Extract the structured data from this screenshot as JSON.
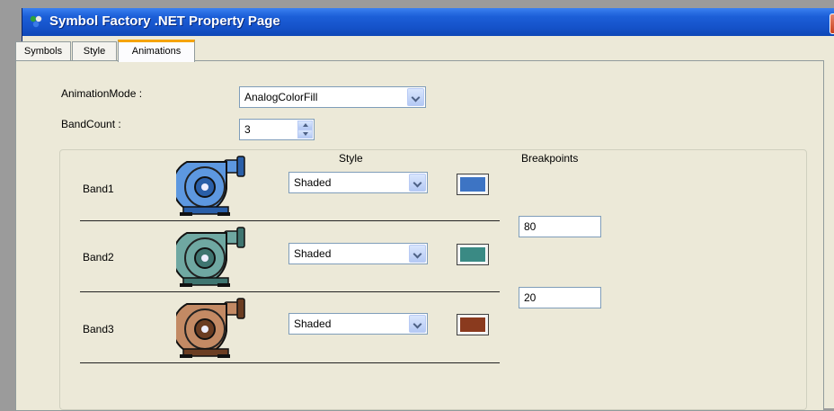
{
  "window": {
    "title": "Symbol Factory .NET Property Page",
    "icon": "app-icon"
  },
  "tabs": [
    {
      "label": "Symbols",
      "active": false
    },
    {
      "label": "Style",
      "active": false
    },
    {
      "label": "Animations",
      "active": true
    }
  ],
  "form": {
    "animation_mode_label": "AnimationMode :",
    "animation_mode_value": "AnalogColorFill",
    "band_count_label": "BandCount :",
    "band_count_value": "3"
  },
  "group": {
    "style_header": "Style",
    "breakpoints_header": "Breakpoints"
  },
  "bands": [
    {
      "label": "Band1",
      "style": "Shaded",
      "color": "#3d74c4",
      "pump_color": "#5d98e0",
      "pump_dark": "#2a5fa8"
    },
    {
      "label": "Band2",
      "style": "Shaded",
      "color": "#3a8a84",
      "pump_color": "#6fa8a2",
      "pump_dark": "#3f7570"
    },
    {
      "label": "Band3",
      "style": "Shaded",
      "color": "#8a3a1e",
      "pump_color": "#c38a64",
      "pump_dark": "#6b3d22"
    }
  ],
  "breakpoints": [
    "80",
    "20"
  ]
}
